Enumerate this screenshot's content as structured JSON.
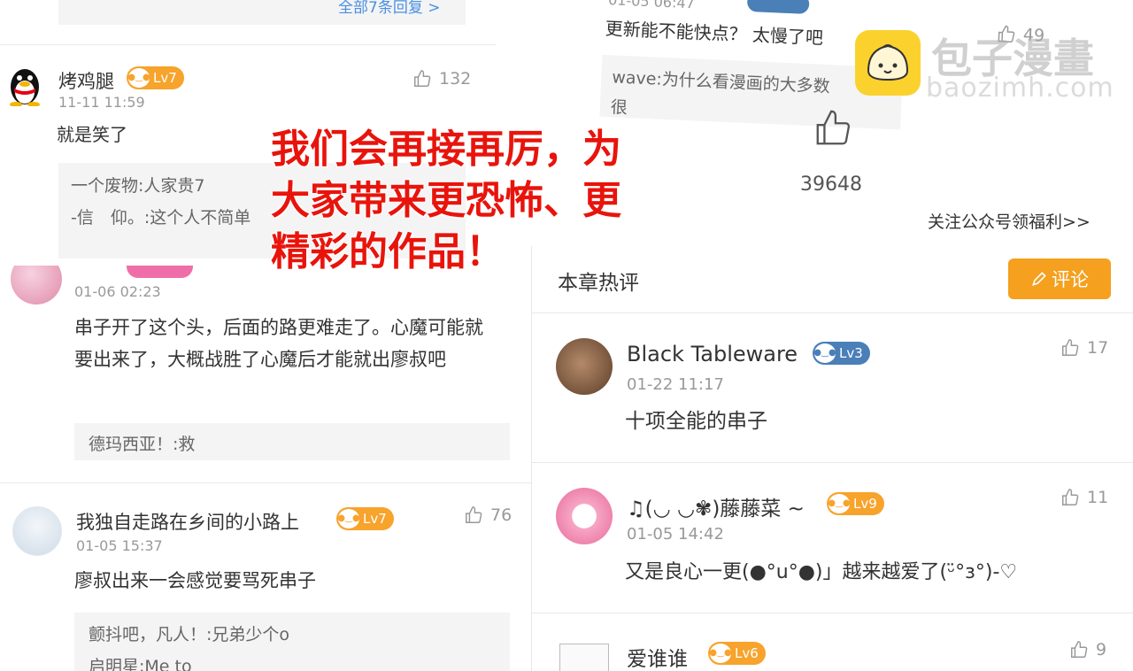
{
  "top_left_panel": {
    "all_replies_link": "全部7条回复 >",
    "comment": {
      "username": "烤鸡腿",
      "level": "Lv7",
      "time": "11-11 11:59",
      "likes": "132",
      "text": "就是笑了",
      "replies": [
        {
          "text": "一个废物:人家贵7"
        },
        {
          "text": "-信　仰。:这个人不简单"
        }
      ]
    }
  },
  "mid_left_panel": {
    "comment": {
      "time": "01-06 02:23",
      "text": "串子开了这个头，后面的路更难走了。心魔可能就要出来了，大概战胜了心魔后才能就出廖叔吧",
      "replies": [
        {
          "text": "德玛西亚！:救"
        }
      ]
    }
  },
  "bottom_left_panel": {
    "comment": {
      "username": "我独自走路在乡间的小路上",
      "level": "Lv7",
      "time": "01-05 15:37",
      "likes": "76",
      "text": "廖叔出来一会感觉要骂死串子",
      "replies": [
        {
          "text": "颤抖吧，凡人！:兄弟少个o"
        },
        {
          "text": "启明星:Me to"
        }
      ]
    }
  },
  "top_right_panel": {
    "time": "01-05 06:47",
    "likes": "49",
    "text": "更新能不能快点？ 太慢了吧",
    "reply_text": "wave:为什么看漫画的大多数",
    "reply_partial_line": "很"
  },
  "right_header": {
    "chapter_likes": "39648",
    "follow_link": "关注公众号领福利>>",
    "section_title": "本章热评",
    "comment_button": "评论"
  },
  "right_comments": [
    {
      "username": "Black Tableware",
      "level": "Lv3",
      "level_color": "#4a7fb8",
      "time": "01-22 11:17",
      "likes": "17",
      "text": "十项全能的串子"
    },
    {
      "username": "♫(◡ ◡✾)藤藤菜 ~",
      "level": "Lv9",
      "level_color": "#f7a32c",
      "time": "01-05 14:42",
      "likes": "11",
      "text": "又是良心一更(●°u°●)」越来越爱了(ᵕ̈°з°)-♡"
    },
    {
      "username": "爱谁谁",
      "level": "Lv6",
      "level_color": "#f7a32c",
      "likes": "9"
    }
  ],
  "overlay_text": {
    "line1": "我们会再接再厉，为",
    "line2": "大家带来更恐怖、更",
    "line3": "精彩的作品！"
  },
  "watermark": {
    "brand": "包子漫畫",
    "domain": "baozimh.com"
  },
  "colors": {
    "overlay_red": "#e8140c",
    "accent_orange": "#f7a32c",
    "button_orange": "#f5a01e",
    "level_blue": "#4a7fb8"
  }
}
